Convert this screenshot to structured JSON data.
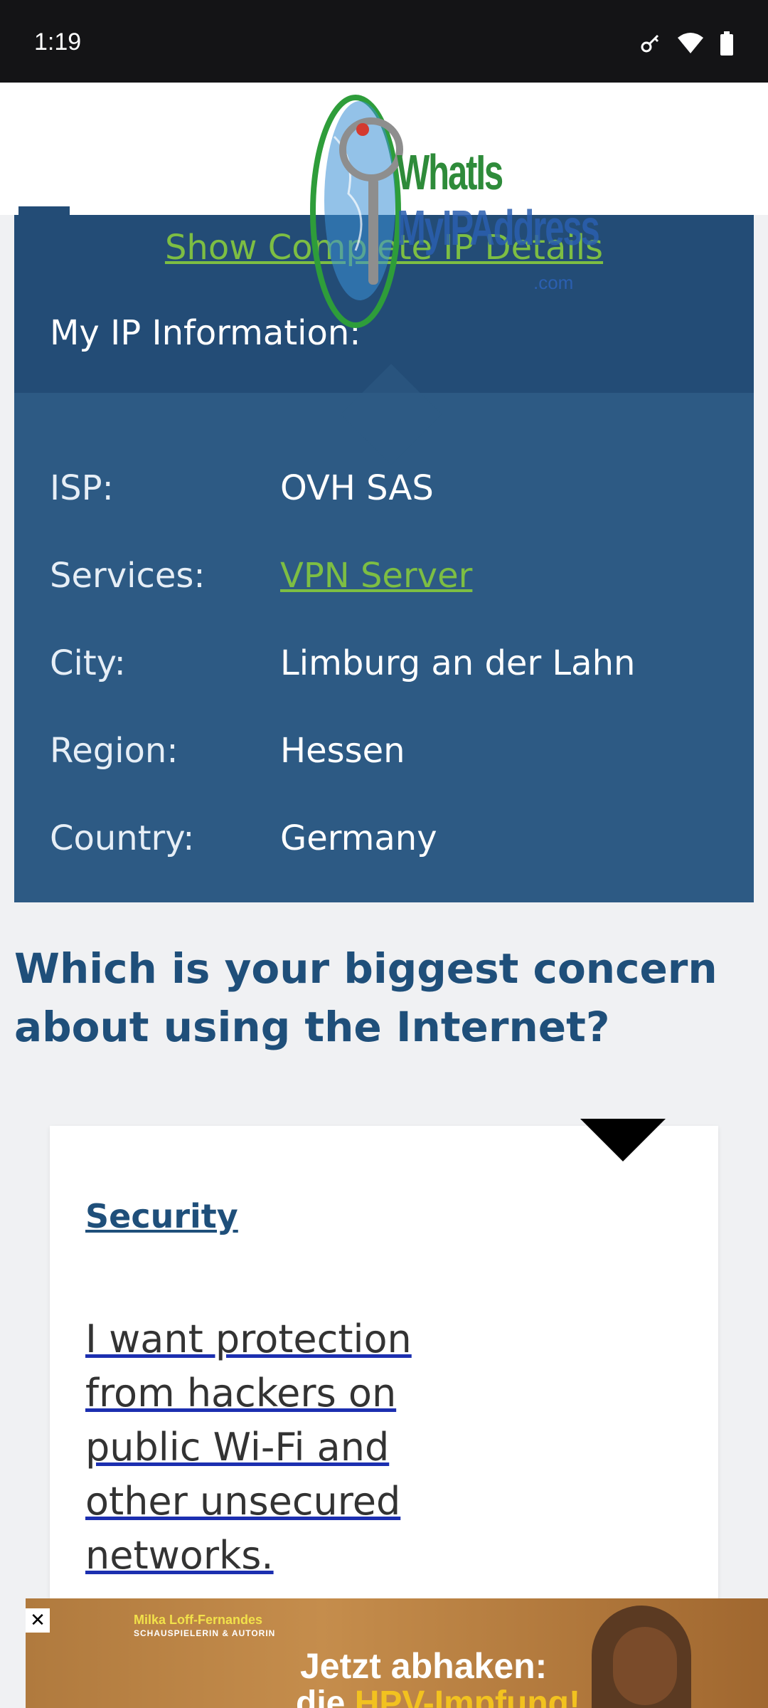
{
  "status_bar": {
    "time": "1:19"
  },
  "logo": {
    "line1": "WhatIs",
    "line2": "MyIPAddress",
    "suffix": ".com"
  },
  "ip_card": {
    "show_details_link": "Show Complete IP Details",
    "title": "My IP Information:",
    "rows": [
      {
        "key": "ISP:",
        "value": "OVH SAS"
      },
      {
        "key": "Services:",
        "value": "VPN Server"
      },
      {
        "key": "City:",
        "value": "Limburg an der Lahn"
      },
      {
        "key": "Region:",
        "value": "Hessen"
      },
      {
        "key": "Country:",
        "value": "Germany"
      }
    ]
  },
  "poll": {
    "question": "Which is your biggest concern about using the Internet?",
    "option_label": "Security",
    "option_text": "I want protection from hackers on public Wi-Fi and other unsecured networks."
  },
  "ad": {
    "close": "✕",
    "name": "Milka Loff-Fernandes",
    "role": "SCHAUSPIELERIN & AUTORIN",
    "line1": "Jetzt abhaken:",
    "line2_prefix": "die ",
    "line2_highlight": "HPV-Impfung!"
  },
  "colors": {
    "brand_blue": "#234c76",
    "link_green": "#7dbe43",
    "heading_blue": "#1f4f7a"
  }
}
